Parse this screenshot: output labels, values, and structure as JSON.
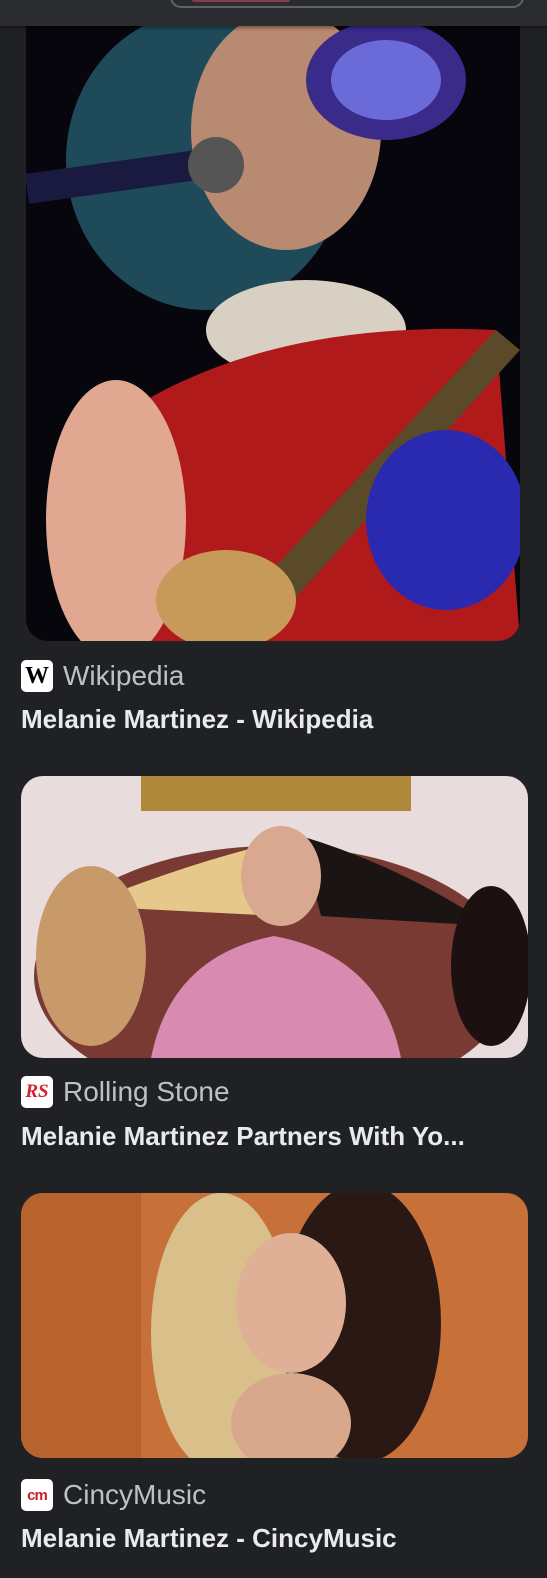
{
  "results": [
    {
      "source": "Wikipedia",
      "favicon": "W",
      "title": "Melanie Martinez - Wikipedia"
    },
    {
      "source": "Rolling Stone",
      "favicon": "RS",
      "title": "Melanie Martinez Partners With Yo..."
    },
    {
      "source": "CincyMusic",
      "favicon": "cm",
      "title": "Melanie Martinez - CincyMusic"
    }
  ],
  "colors": {
    "background": "#202124",
    "title_text": "#e8eaed",
    "source_text": "#bdc1c6"
  }
}
